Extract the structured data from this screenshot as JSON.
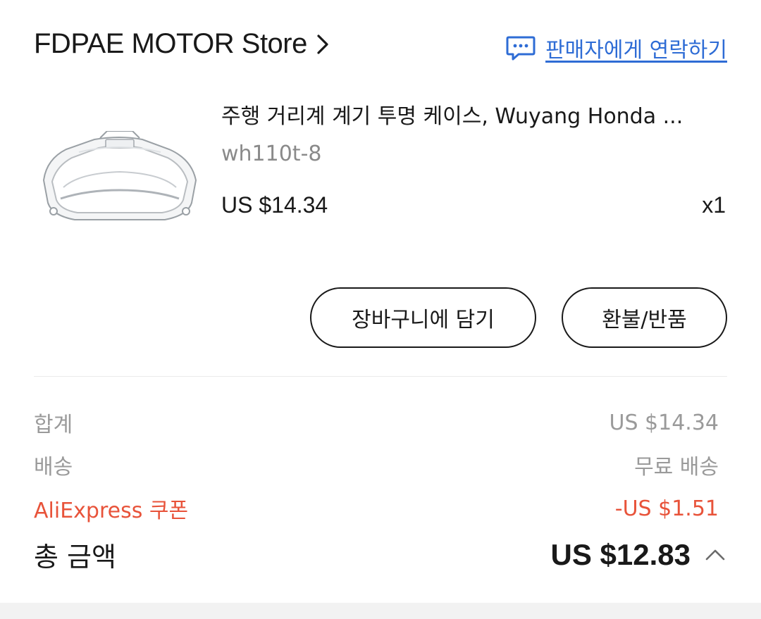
{
  "store": {
    "name": "FDPAE MOTOR Store",
    "contact_label": "판매자에게 연락하기"
  },
  "product": {
    "title": "주행 거리계 계기 투명 케이스, Wuyang Honda ...",
    "variant": "wh110t-8",
    "price": "US $14.34",
    "quantity": "x1"
  },
  "actions": {
    "add_to_cart": "장바구니에 담기",
    "refund_return": "환불/반품"
  },
  "summary": {
    "subtotal_label": "합계",
    "subtotal_value": "US $14.34",
    "shipping_label": "배송",
    "shipping_value": "무료 배송",
    "coupon_label": "AliExpress 쿠폰",
    "coupon_value": "-US $1.51",
    "total_label": "총 금액",
    "total_value": "US $12.83"
  },
  "colors": {
    "link_blue": "#2e6cd5",
    "coupon_red": "#e8533a",
    "muted_gray": "#9a9a9a",
    "text_dark": "#191919"
  },
  "icons": {
    "store_arrow": "chevron-right-icon",
    "contact": "chat-bubble-icon",
    "total_toggle": "chevron-up-icon"
  }
}
